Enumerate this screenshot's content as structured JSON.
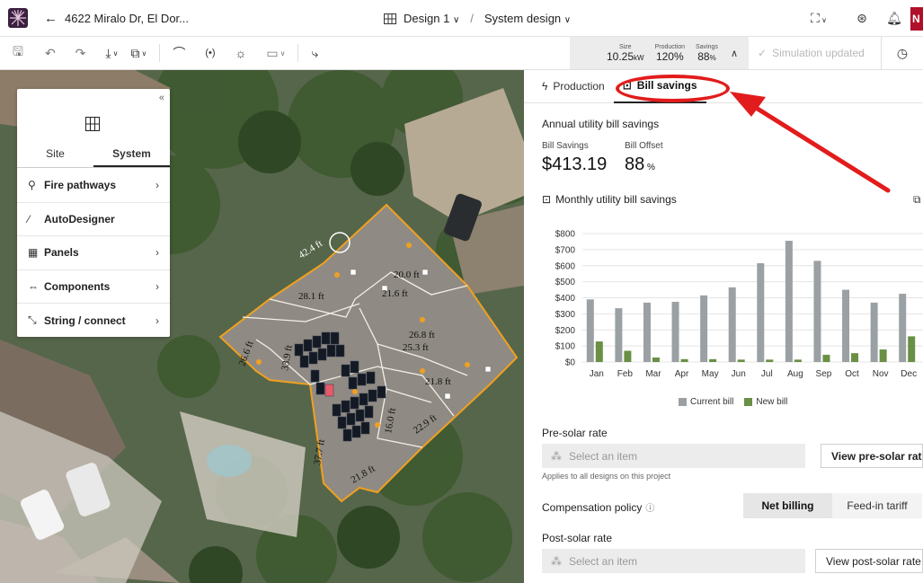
{
  "header": {
    "back_label": "4622 Miralo Dr, El Dor...",
    "design_label": "Design 1",
    "separator": "/",
    "view_label": "System design",
    "avatar_initial": "N"
  },
  "toolbar": {
    "stats": {
      "size_label": "Size",
      "size_value": "10.25",
      "size_unit": "kW",
      "production_label": "Production",
      "production_value": "120%",
      "savings_label": "Savings",
      "savings_value": "88",
      "savings_unit": "%"
    },
    "simulation_status": "Simulation updated"
  },
  "sidepanel": {
    "tabs": [
      "Site",
      "System"
    ],
    "active_tab": "System",
    "items": [
      {
        "label": "Fire pathways",
        "icon": "fire-pathway-icon",
        "has_chevron": true
      },
      {
        "label": "AutoDesigner",
        "icon": "wand-icon",
        "has_chevron": false
      },
      {
        "label": "Panels",
        "icon": "panels-grid-icon",
        "has_chevron": true
      },
      {
        "label": "Components",
        "icon": "component-icon",
        "has_chevron": true
      },
      {
        "label": "String / connect",
        "icon": "string-connect-icon",
        "has_chevron": true
      }
    ]
  },
  "map": {
    "roof_labels": [
      "42.4 ft",
      "20.0 ft",
      "21.6 ft",
      "28.1 ft",
      "26.8 ft",
      "25.3 ft",
      "21.8 ft",
      "22.9 ft",
      "21.8 ft",
      "37.7 ft",
      "33.9 ft",
      "26.6 ft",
      "16.0 ft"
    ]
  },
  "rpanel": {
    "tabs": [
      {
        "label": "Production",
        "icon": "bolt-icon"
      },
      {
        "label": "Bill savings",
        "icon": "bill-icon"
      }
    ],
    "active_tab": "Bill savings",
    "annual_title": "Annual utility bill savings",
    "bill_savings_label": "Bill Savings",
    "bill_savings_value": "$413.19",
    "bill_offset_label": "Bill Offset",
    "bill_offset_value": "88",
    "bill_offset_unit": "%",
    "monthly_title": "Monthly utility bill savings",
    "pre_solar_label": "Pre-solar rate",
    "pre_solar_placeholder": "Select an item",
    "pre_solar_button": "View pre-solar rate",
    "pre_solar_note": "Applies to all designs on this project",
    "compensation_label": "Compensation policy",
    "compensation_options": [
      "Net billing",
      "Feed-in tariff"
    ],
    "compensation_selected": "Net billing",
    "post_solar_label": "Post-solar rate",
    "post_solar_placeholder": "Select an item",
    "post_solar_button": "View post-solar rate"
  },
  "chart_data": {
    "type": "bar",
    "title": "Monthly utility bill savings",
    "categories": [
      "Jan",
      "Feb",
      "Mar",
      "Apr",
      "May",
      "Jun",
      "Jul",
      "Aug",
      "Sep",
      "Oct",
      "Nov",
      "Dec"
    ],
    "series": [
      {
        "name": "Current bill",
        "color": "#9aa0a4",
        "values": [
          390,
          335,
          370,
          375,
          415,
          465,
          615,
          755,
          630,
          450,
          370,
          425
        ]
      },
      {
        "name": "New bill",
        "color": "#6a8f45",
        "values": [
          128,
          70,
          28,
          18,
          18,
          15,
          15,
          15,
          45,
          55,
          78,
          160
        ]
      }
    ],
    "yticks": [
      "$0",
      "$100",
      "$200",
      "$300",
      "$400",
      "$500",
      "$600",
      "$700",
      "$800"
    ],
    "ylim": [
      0,
      800
    ],
    "grid": true,
    "legend_position": "bottom"
  },
  "colors": {
    "highlight": "#e21c1c",
    "roof_outline": "#f0a020",
    "panel": "#1a1f2a",
    "selected_panel": "#e85a6a"
  }
}
